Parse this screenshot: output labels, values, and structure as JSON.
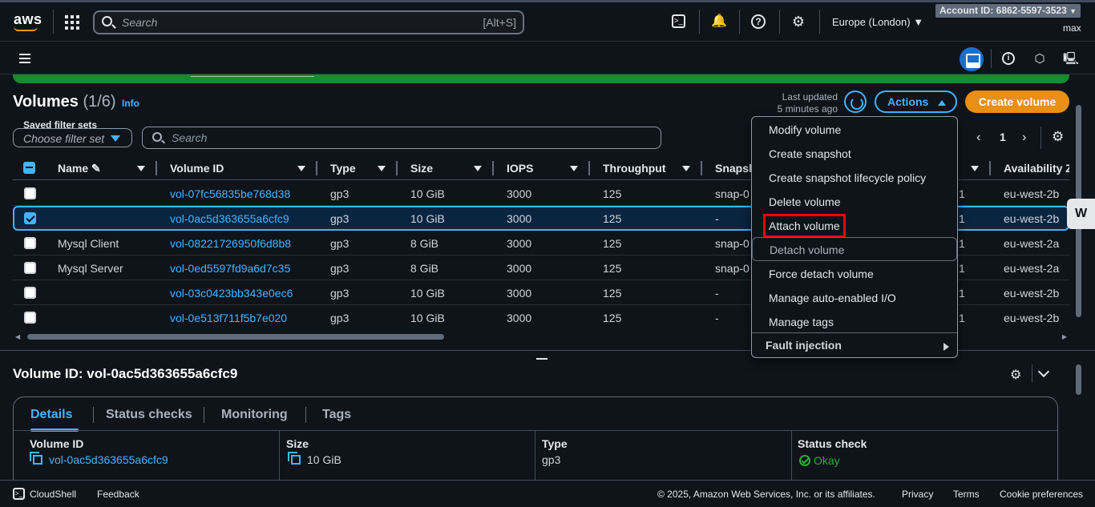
{
  "topnav": {
    "logo": "aws",
    "search_placeholder": "Search",
    "search_shortcut": "[Alt+S]",
    "region": "Europe (London)",
    "account": "Account ID: 6862-5597-3523",
    "user": "max",
    "icons": [
      "services-grid-icon",
      "search-icon",
      "cloudshell-icon",
      "bell-icon",
      "help-icon",
      "settings-icon"
    ]
  },
  "page": {
    "title": "Volumes",
    "count": "(1/6)",
    "info": "Info",
    "last_updated_line1": "Last updated",
    "last_updated_line2": "5 minutes ago",
    "actions_label": "Actions",
    "create_label": "Create volume",
    "saved_filter_label": "Saved filter sets",
    "saved_filter_placeholder": "Choose filter set",
    "search_placeholder": "Search",
    "page_number": "1"
  },
  "table": {
    "columns": [
      "Name",
      "Volume ID",
      "Type",
      "Size",
      "IOPS",
      "Throughput",
      "Snapsh",
      "Availability Z"
    ],
    "rows": [
      {
        "name": "",
        "volume_id": "vol-07fc56835be768d38",
        "type": "gp3",
        "size": "10 GiB",
        "iops": "3000",
        "throughput": "125",
        "snapshot": "snap-0",
        "snap_tail": "1",
        "az": "eu-west-2b",
        "selected": false
      },
      {
        "name": "",
        "volume_id": "vol-0ac5d363655a6cfc9",
        "type": "gp3",
        "size": "10 GiB",
        "iops": "3000",
        "throughput": "125",
        "snapshot": "-",
        "snap_tail": "1",
        "az": "eu-west-2b",
        "selected": true
      },
      {
        "name": "Mysql Client",
        "volume_id": "vol-08221726950f6d8b8",
        "type": "gp3",
        "size": "8 GiB",
        "iops": "3000",
        "throughput": "125",
        "snapshot": "snap-0",
        "snap_tail": "1",
        "az": "eu-west-2a",
        "selected": false
      },
      {
        "name": "Mysql Server",
        "volume_id": "vol-0ed5597fd9a6d7c35",
        "type": "gp3",
        "size": "8 GiB",
        "iops": "3000",
        "throughput": "125",
        "snapshot": "snap-0",
        "snap_tail": "1",
        "az": "eu-west-2a",
        "selected": false
      },
      {
        "name": "",
        "volume_id": "vol-03c0423bb343e0ec6",
        "type": "gp3",
        "size": "10 GiB",
        "iops": "3000",
        "throughput": "125",
        "snapshot": "-",
        "snap_tail": "1",
        "az": "eu-west-2b",
        "selected": false
      },
      {
        "name": "",
        "volume_id": "vol-0e513f711f5b7e020",
        "type": "gp3",
        "size": "10 GiB",
        "iops": "3000",
        "throughput": "125",
        "snapshot": "-",
        "snap_tail": "1",
        "az": "eu-west-2b",
        "selected": false
      }
    ]
  },
  "menu": {
    "items": [
      "Modify volume",
      "Create snapshot",
      "Create snapshot lifecycle policy",
      "Delete volume",
      "Attach volume",
      "Detach volume",
      "Force detach volume",
      "Manage auto-enabled I/O",
      "Manage tags"
    ],
    "highlighted": "Attach volume",
    "fault_injection": "Fault injection"
  },
  "details": {
    "title": "Volume ID: vol-0ac5d363655a6cfc9",
    "tabs": [
      "Details",
      "Status checks",
      "Monitoring",
      "Tags"
    ],
    "active_tab": "Details",
    "fields": [
      {
        "label": "Volume ID",
        "value": "vol-0ac5d363655a6cfc9"
      },
      {
        "label": "Size",
        "value": "10 GiB"
      },
      {
        "label": "Type",
        "value": "gp3"
      },
      {
        "label": "Status check",
        "value": "Okay"
      }
    ]
  },
  "footer": {
    "cloudshell": "CloudShell",
    "feedback": "Feedback",
    "copyright": "© 2025, Amazon Web Services, Inc. or its affiliates.",
    "privacy": "Privacy",
    "terms": "Terms",
    "cookies": "Cookie preferences"
  },
  "colors": {
    "accent": "#42b4ff",
    "create_button": "#e88f14",
    "success_banner": "#168c2f",
    "highlight_box": "#e00000"
  }
}
